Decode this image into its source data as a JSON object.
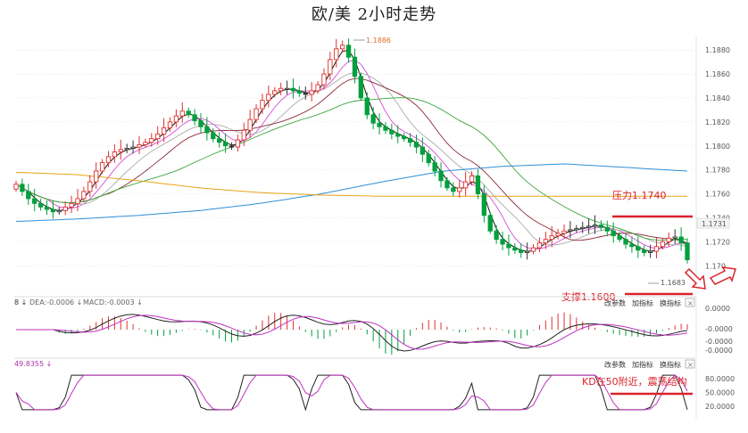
{
  "title": "欧/美 2小时走势",
  "colors": {
    "up": "#00a03c",
    "down": "#e0302f",
    "doji": "#333333",
    "annotation": "#d9232d",
    "ma5": "#111111",
    "ma10": "#d64dd6",
    "ma20": "#aaaaaa",
    "ma30": "#8b2b3a",
    "ma60": "#3aa83a",
    "ma120": "#2f8fd6",
    "ma250": "#e8a317"
  },
  "price_axis": {
    "ticks": [
      "1.1880",
      "1.1860",
      "1.1840",
      "1.1820",
      "1.1800",
      "1.1780",
      "1.1760",
      "1.1740",
      "1.1720",
      "1.170"
    ],
    "current": "1.1731",
    "ylim": [
      1.1695,
      1.1892
    ]
  },
  "markers": {
    "high_label": "1.1886",
    "low_label": "1.1683"
  },
  "annotations": {
    "resistance": "压力1.1740",
    "support": "支撑1.1600",
    "kd_note": "KD在50附近，震荡结构"
  },
  "macd_panel": {
    "header_prefix": "8 ↓",
    "dea": "DEA:-0.0006 ↓",
    "macd": "MACD:-0.0003 ↓",
    "ticks": [
      "0.0000",
      "-0.0000",
      "-0.0000",
      "-0.0000"
    ],
    "controls": [
      "改参数",
      "加指标",
      "换指标"
    ],
    "close": "×"
  },
  "kd_panel": {
    "header": "49.8355 ↓",
    "ticks": [
      "80.0000",
      "50.0000",
      "20.0000"
    ],
    "controls": [
      "改参数",
      "加指标",
      "换指标"
    ],
    "close": "×"
  },
  "chart_data": {
    "type": "candlestick",
    "title": "欧/美 2小时走势",
    "ylim": [
      1.1695,
      1.1892
    ],
    "close": [
      1.1768,
      1.1762,
      1.1756,
      1.1752,
      1.1749,
      1.1747,
      1.1745,
      1.1746,
      1.1749,
      1.1752,
      1.1756,
      1.1762,
      1.177,
      1.1779,
      1.1786,
      1.1791,
      1.1795,
      1.1797,
      1.1798,
      1.1799,
      1.1801,
      1.1803,
      1.1806,
      1.181,
      1.1815,
      1.182,
      1.1825,
      1.1829,
      1.1826,
      1.1821,
      1.1816,
      1.1811,
      1.1806,
      1.1803,
      1.18,
      1.1799,
      1.1805,
      1.1813,
      1.1822,
      1.1831,
      1.1838,
      1.1843,
      1.1846,
      1.1848,
      1.1848,
      1.1846,
      1.1844,
      1.1843,
      1.1846,
      1.1851,
      1.186,
      1.1872,
      1.1881,
      1.1884,
      1.1874,
      1.1858,
      1.184,
      1.1826,
      1.1819,
      1.1816,
      1.1813,
      1.181,
      1.1808,
      1.1806,
      1.1803,
      1.1799,
      1.1793,
      1.1786,
      1.1779,
      1.1771,
      1.1765,
      1.1762,
      1.1765,
      1.177,
      1.1775,
      1.176,
      1.1742,
      1.1729,
      1.1722,
      1.1718,
      1.1715,
      1.1713,
      1.1711,
      1.1712,
      1.1715,
      1.1719,
      1.1722,
      1.1725,
      1.1727,
      1.1729,
      1.173,
      1.1731,
      1.1732,
      1.1733,
      1.1734,
      1.1732,
      1.1729,
      1.1725,
      1.1722,
      1.1718,
      1.1716,
      1.1713,
      1.1711,
      1.1712,
      1.1716,
      1.172,
      1.1723,
      1.1724,
      1.1719,
      1.1705
    ],
    "series": [
      {
        "name": "MA5",
        "color": "#111111",
        "smoothing": 2
      },
      {
        "name": "MA10",
        "color": "#d64dd6",
        "smoothing": 5
      },
      {
        "name": "MA20",
        "color": "#aaaaaa",
        "smoothing": 9
      },
      {
        "name": "MA30",
        "color": "#8b2b3a",
        "smoothing": 14
      },
      {
        "name": "MA60",
        "color": "#3aa83a",
        "smoothing": 26
      },
      {
        "name": "MA120",
        "color": "#2f8fd6",
        "values": [
          1.1737,
          1.1739,
          1.1742,
          1.1746,
          1.1752,
          1.176,
          1.177,
          1.1779,
          1.1783,
          1.1785,
          1.1782,
          1.1779
        ]
      },
      {
        "name": "MA250",
        "color": "#e8a317",
        "values": [
          1.1778,
          1.1776,
          1.1771,
          1.1765,
          1.1761,
          1.1759,
          1.1758,
          1.1758,
          1.1758,
          1.1758,
          1.1758,
          1.1758
        ]
      }
    ],
    "resistance": 1.174,
    "support": 1.16
  }
}
